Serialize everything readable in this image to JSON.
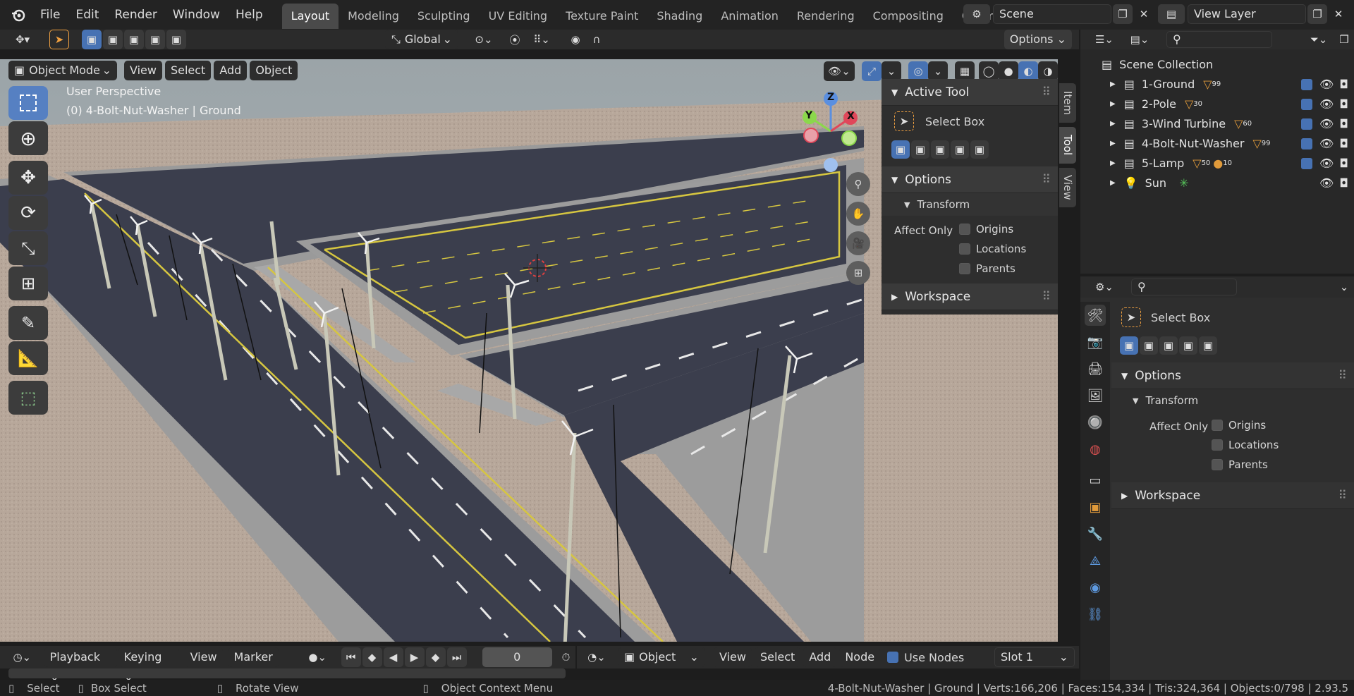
{
  "topbar": {
    "menus": [
      "File",
      "Edit",
      "Render",
      "Window",
      "Help"
    ],
    "workspaces": [
      "Layout",
      "Modeling",
      "Sculpting",
      "UV Editing",
      "Texture Paint",
      "Shading",
      "Animation",
      "Rendering",
      "Compositing",
      "Geometry Nod"
    ],
    "active_workspace": "Layout",
    "scene": "Scene",
    "view_layer": "View Layer"
  },
  "viewport_header": {
    "transform_orientation": "Global",
    "options_label": "Options",
    "mode": "Object Mode",
    "menus": [
      "View",
      "Select",
      "Add",
      "Object"
    ]
  },
  "viewport": {
    "perspective_label": "User Perspective",
    "object_label": "(0) 4-Bolt-Nut-Washer | Ground",
    "gizmo_axes": {
      "x": "X",
      "y": "Y",
      "z": "Z"
    }
  },
  "n_panel": {
    "tabs": [
      "Item",
      "Tool",
      "View"
    ],
    "active_tab": "Tool",
    "active_tool_title": "Active Tool",
    "tool_name": "Select Box",
    "options_title": "Options",
    "transform_title": "Transform",
    "affect_only_label": "Affect Only",
    "checks": [
      "Origins",
      "Locations",
      "Parents"
    ],
    "workspace_title": "Workspace"
  },
  "outliner": {
    "root": "Scene Collection",
    "items": [
      {
        "name": "1-Ground",
        "badge": "99"
      },
      {
        "name": "2-Pole",
        "badge": "30"
      },
      {
        "name": "3-Wind Turbine",
        "badge": "60"
      },
      {
        "name": "4-Bolt-Nut-Washer",
        "badge": "99"
      },
      {
        "name": "5-Lamp",
        "badge": "50",
        "badge2": "10"
      },
      {
        "name": "Sun",
        "badge": ""
      }
    ]
  },
  "properties": {
    "tool_name": "Select Box",
    "options_title": "Options",
    "transform_title": "Transform",
    "affect_only_label": "Affect Only",
    "checks": [
      "Origins",
      "Locations",
      "Parents"
    ],
    "workspace_title": "Workspace"
  },
  "timeline": {
    "menus": [
      "Playback",
      "Keying",
      "View",
      "Marker"
    ],
    "frame": "0"
  },
  "node_header": {
    "type": "Object",
    "menus": [
      "View",
      "Select",
      "Add",
      "Node"
    ],
    "use_nodes_label": "Use Nodes",
    "slot": "Slot 1"
  },
  "statusbar": {
    "select": "Select",
    "box_select": "Box Select",
    "rotate_view": "Rotate View",
    "context_menu": "Object Context Menu",
    "stats": "4-Bolt-Nut-Washer | Ground | Verts:166,206 | Faces:154,334 | Tris:324,364 | Objects:0/798 | 2.93.5"
  },
  "colors": {
    "accent": "#4772b3",
    "asphalt": "#3b3e4d",
    "sand": "#b9a89a",
    "sidewalk": "#9a9a9a"
  }
}
